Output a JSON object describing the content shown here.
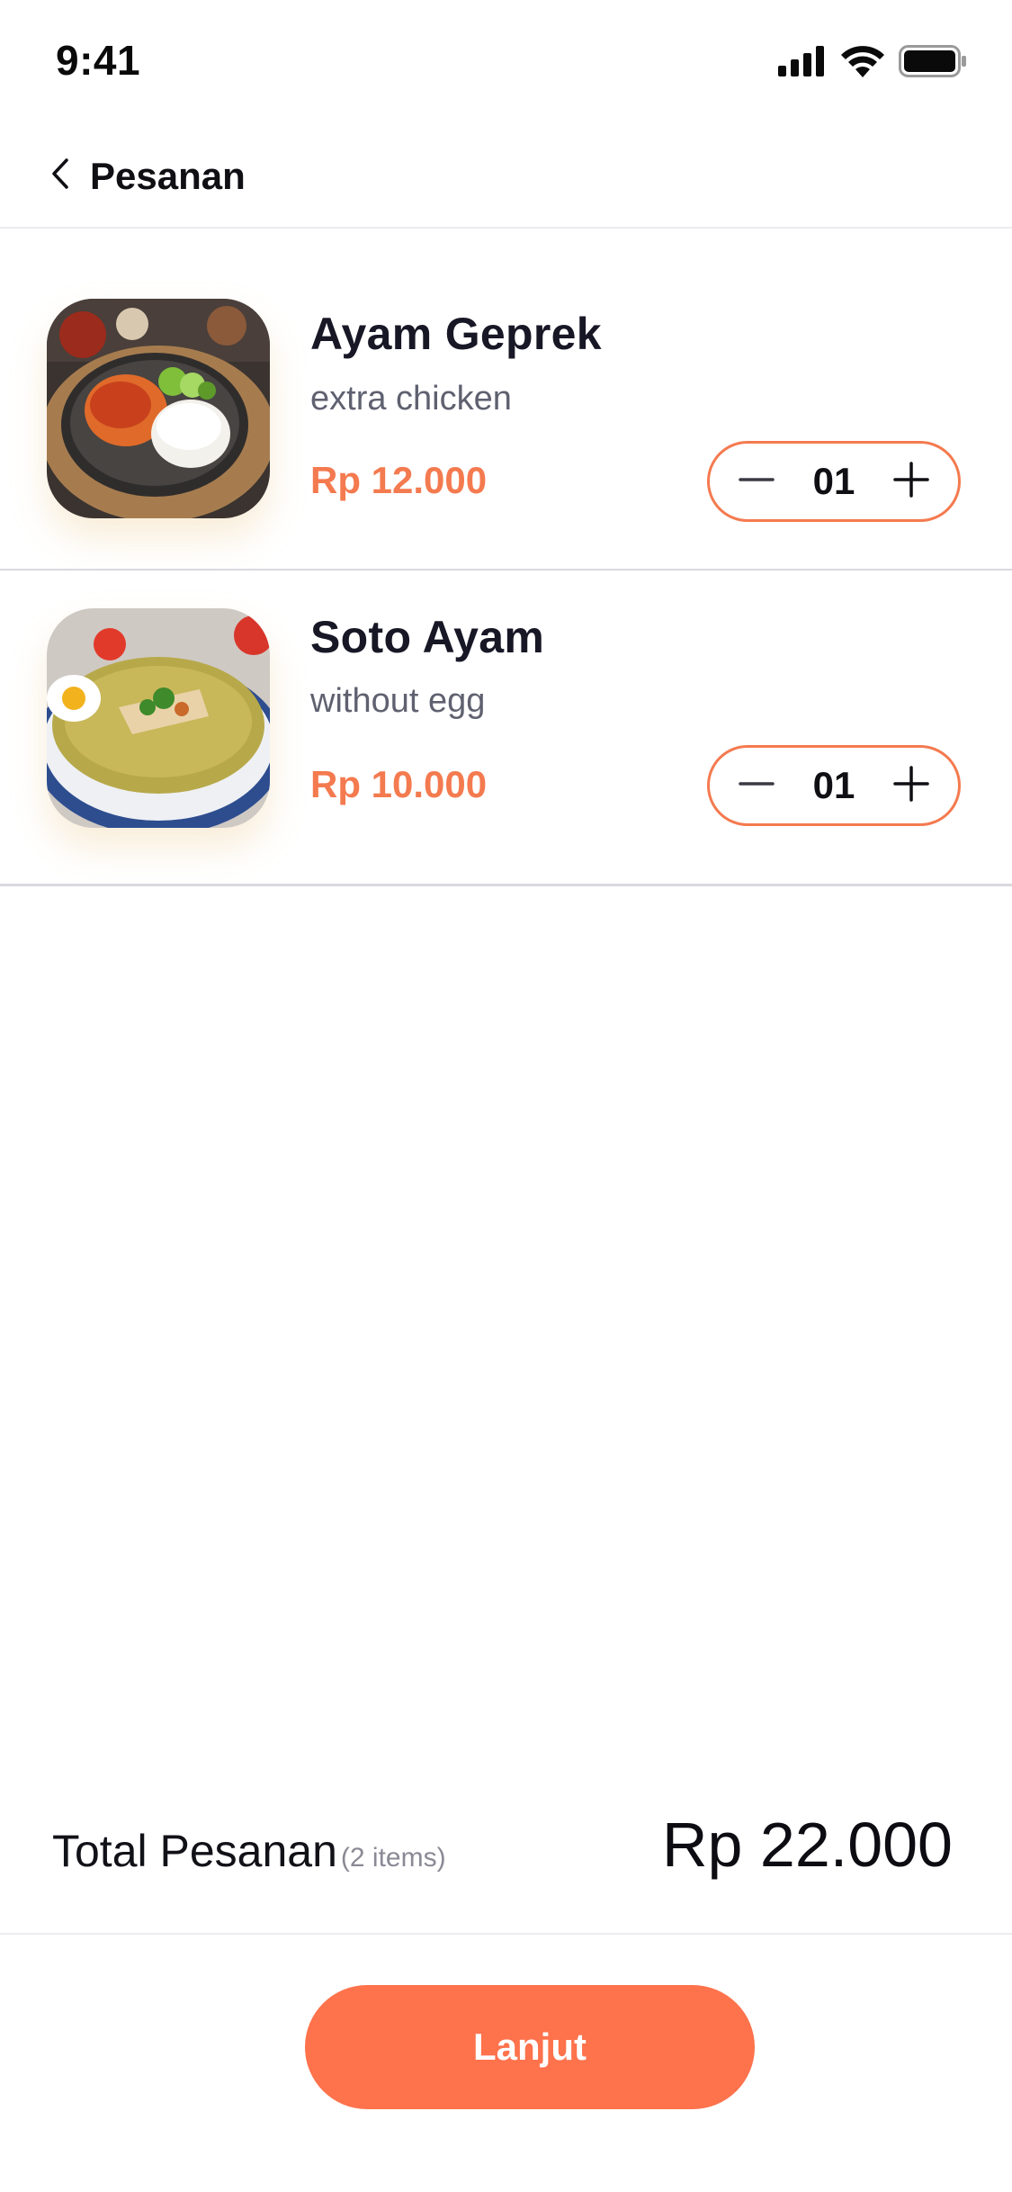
{
  "status_bar": {
    "time": "9:41",
    "icons": [
      "cellular-signal-icon",
      "wifi-icon",
      "battery-icon"
    ]
  },
  "header": {
    "back_icon": "chevron-left-icon",
    "title": "Pesanan"
  },
  "orders": [
    {
      "name": "Ayam Geprek",
      "note": "extra chicken",
      "price": "Rp 12.000",
      "quantity": "01",
      "image": "ayam-geprek-photo"
    },
    {
      "name": "Soto Ayam",
      "note": "without egg",
      "price": "Rp 10.000",
      "quantity": "01",
      "image": "soto-ayam-photo"
    }
  ],
  "summary": {
    "label": "Total Pesanan",
    "items_count": "(2 items)",
    "total": "Rp 22.000"
  },
  "action": {
    "continue_label": "Lanjut"
  },
  "colors": {
    "accent": "#fe724c",
    "price": "#f47a4f",
    "text_primary": "#171726",
    "text_secondary": "#5f6170"
  }
}
